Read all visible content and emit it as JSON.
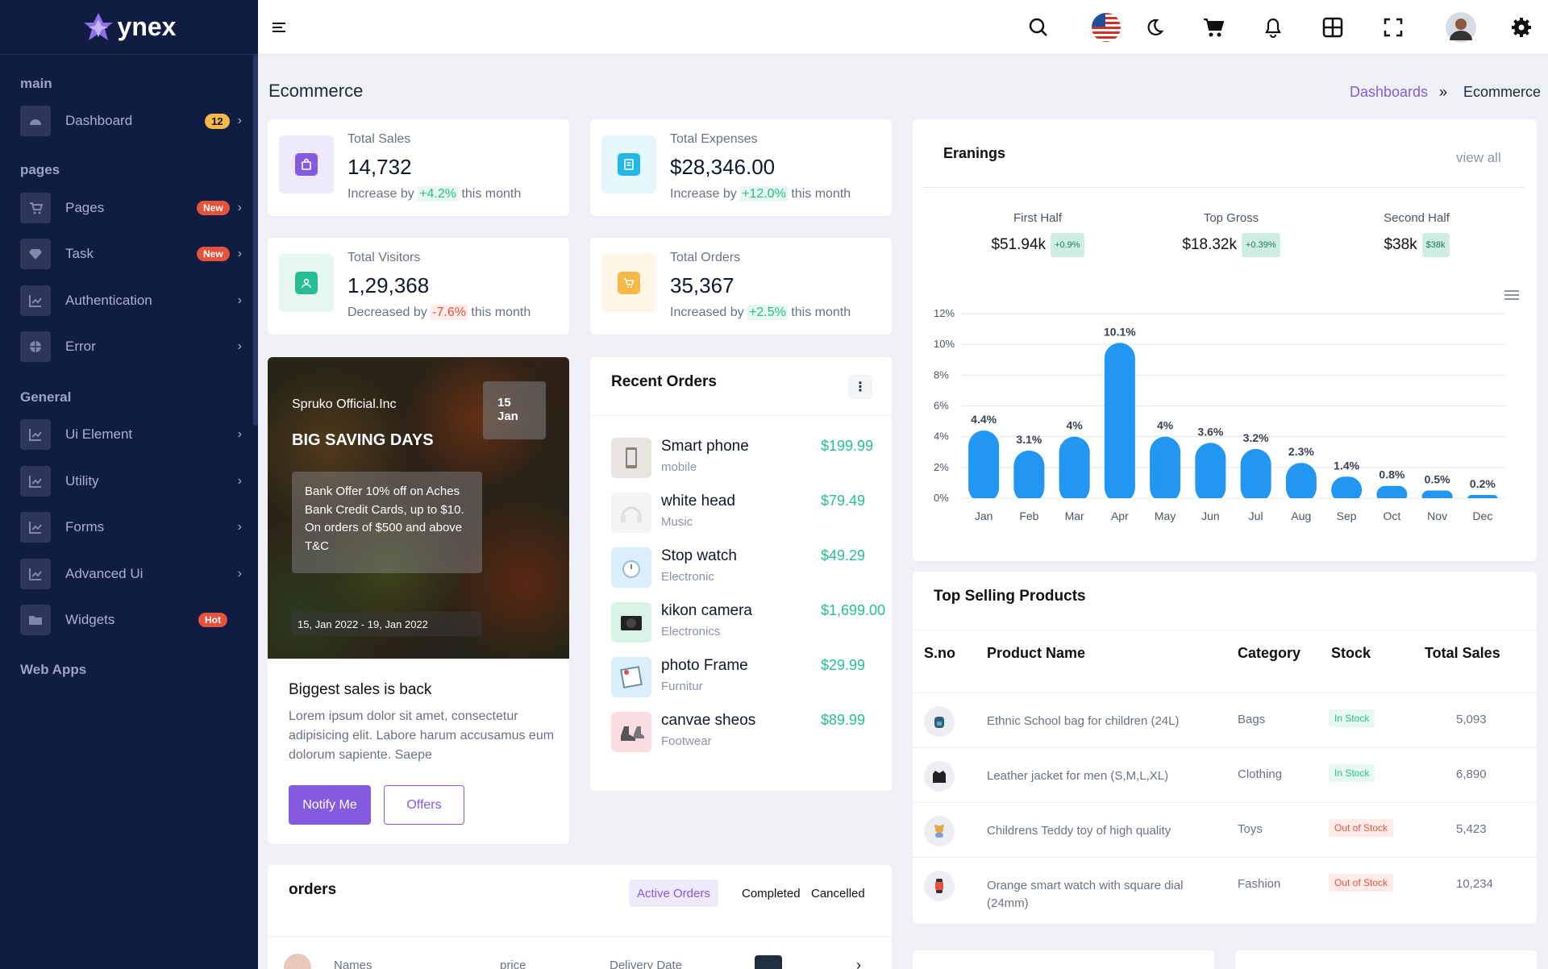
{
  "brand": {
    "name": "ynex"
  },
  "sidebar": {
    "sections": {
      "main": "main",
      "pages": "pages",
      "general": "General",
      "web_apps": "Web Apps"
    },
    "items": [
      {
        "label": "Dashboard",
        "badge": "12"
      },
      {
        "label": "Pages",
        "badge": "New"
      },
      {
        "label": "Task",
        "badge": "New"
      },
      {
        "label": "Authentication"
      },
      {
        "label": "Error"
      },
      {
        "label": "Ui Element"
      },
      {
        "label": "Utility"
      },
      {
        "label": "Forms"
      },
      {
        "label": "Advanced Ui"
      },
      {
        "label": "Widgets",
        "badge": "Hot"
      }
    ]
  },
  "page": {
    "title": "Ecommerce",
    "breadcrumb": [
      "Dashboards",
      "»",
      "Ecommerce"
    ]
  },
  "stats": [
    {
      "label": "Total Sales",
      "value": "14,732",
      "prefix": "Increase by",
      "change": "+4.2%",
      "suffix": "this month"
    },
    {
      "label": "Total Expenses",
      "value": "$28,346.00",
      "prefix": "Increase by",
      "change": "+12.0%",
      "suffix": "this month"
    },
    {
      "label": "Total Visitors",
      "value": "1,29,368",
      "prefix": "Decreased by",
      "change": "-7.6%",
      "suffix": "this month"
    },
    {
      "label": "Total Orders",
      "value": "35,367",
      "prefix": "Increased by",
      "change": "+2.5%",
      "suffix": "this month"
    }
  ],
  "promo": {
    "company": "Spruko Official.Inc",
    "headline": "BIG SAVING DAYS",
    "date_day": "15",
    "date_month": "Jan",
    "offer": "Bank Offer 10% off on Aches Bank Credit Cards, up to $10. On orders of $500 and above T&C",
    "range": "15, Jan 2022 - 19, Jan 2022",
    "title": "Biggest sales is back",
    "body": "Lorem ipsum dolor sit amet, consectetur adipisicing elit. Labore harum accusamus eum dolorum sapiente. Saepe",
    "notify": "Notify Me",
    "offers": "Offers"
  },
  "recent_orders": {
    "title": "Recent Orders",
    "items": [
      {
        "name": "Smart phone",
        "category": "mobile",
        "price": "$199.99"
      },
      {
        "name": "white head",
        "category": "Music",
        "price": "$79.49"
      },
      {
        "name": "Stop watch",
        "category": "Electronic",
        "price": "$49.29"
      },
      {
        "name": "kikon camera",
        "category": "Electronics",
        "price": "$1,699.00"
      },
      {
        "name": "photo Frame",
        "category": "Furnitur",
        "price": "$29.99"
      },
      {
        "name": "canvae sheos",
        "category": "Footwear",
        "price": "$89.99"
      }
    ]
  },
  "earnings": {
    "title": "Eranings",
    "view_all": "view all",
    "summary": [
      {
        "label": "First Half",
        "value": "$51.94k",
        "tag": "+0.9%"
      },
      {
        "label": "Top Gross",
        "value": "$18.32k",
        "tag": "+0.39%"
      },
      {
        "label": "Second Half",
        "value": "$38k",
        "tag": "$38k"
      }
    ]
  },
  "chart_data": {
    "type": "bar",
    "categories": [
      "Jan",
      "Feb",
      "Mar",
      "Apr",
      "May",
      "Jun",
      "Jul",
      "Aug",
      "Sep",
      "Oct",
      "Nov",
      "Dec"
    ],
    "values": [
      4.4,
      3.1,
      4,
      10.1,
      4,
      3.6,
      3.2,
      2.3,
      1.4,
      0.8,
      0.5,
      0.2
    ],
    "labels": [
      "4.4%",
      "3.1%",
      "4%",
      "10.1%",
      "4%",
      "3.6%",
      "3.2%",
      "2.3%",
      "1.4%",
      "0.8%",
      "0.5%",
      "0.2%"
    ],
    "yticks": [
      "0%",
      "2%",
      "4%",
      "6%",
      "8%",
      "10%",
      "12%"
    ],
    "ylim": [
      0,
      12
    ],
    "grid": true,
    "color": "#2196f3"
  },
  "top_selling": {
    "title": "Top Selling Products",
    "headers": [
      "S.no",
      "Product Name",
      "Category",
      "Stock",
      "Total Sales"
    ],
    "rows": [
      {
        "name": "Ethnic School bag for children (24L)",
        "category": "Bags",
        "stock": "In Stock",
        "total": "5,093"
      },
      {
        "name": "Leather jacket for men (S,M,L,XL)",
        "category": "Clothing",
        "stock": "In Stock",
        "total": "6,890"
      },
      {
        "name": "Childrens Teddy toy of high quality",
        "category": "Toys",
        "stock": "Out of Stock",
        "total": "5,423"
      },
      {
        "name": "Orange smart watch with square dial (24mm)",
        "category": "Fashion",
        "stock": "Out of Stock",
        "total": "10,234"
      }
    ]
  },
  "orders": {
    "title": "orders",
    "tabs": [
      "Active Orders",
      "Completed",
      "Cancelled"
    ],
    "columns": [
      "Names",
      "price",
      "Delivery Date"
    ]
  },
  "colors": {
    "primary": "#845adf",
    "sidebar": "#111c43",
    "success": "#26bf94",
    "danger": "#e6533c",
    "warning": "#f5b849",
    "info": "#23b7e5"
  }
}
